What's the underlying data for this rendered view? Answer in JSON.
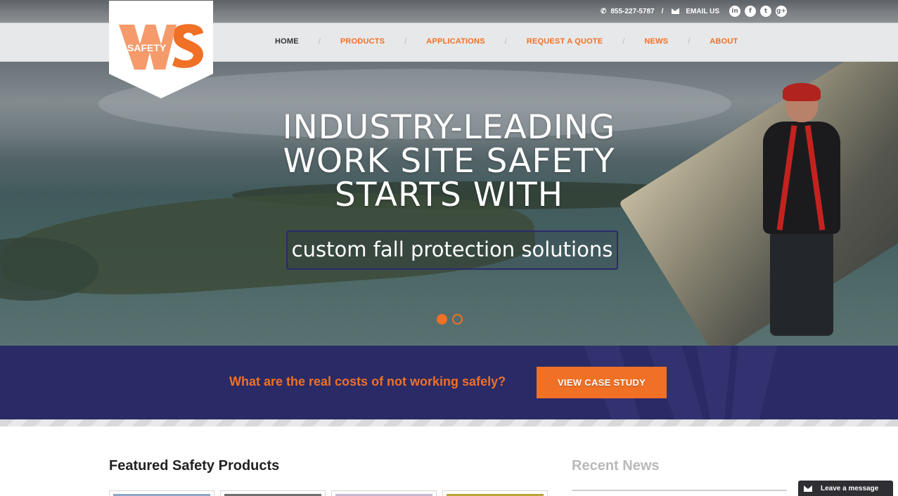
{
  "topbar": {
    "phone": "855-227-5787",
    "separator": "/",
    "email_label": "EMAIL US",
    "social": [
      {
        "name": "linkedin",
        "glyph": "in"
      },
      {
        "name": "facebook",
        "glyph": "f"
      },
      {
        "name": "twitter",
        "glyph": "t"
      },
      {
        "name": "google-plus",
        "glyph": "g+"
      }
    ]
  },
  "logo": {
    "text_left": "SAFETY",
    "text_mark": "WS",
    "brand_color": "#f07025"
  },
  "nav": {
    "items": [
      {
        "label": "HOME",
        "active": true
      },
      {
        "label": "PRODUCTS"
      },
      {
        "label": "APPLICATIONS"
      },
      {
        "label": "REQUEST A QUOTE"
      },
      {
        "label": "NEWS"
      },
      {
        "label": "ABOUT"
      }
    ],
    "divider": "/"
  },
  "hero": {
    "headline_lines": [
      "INDUSTRY-LEADING",
      "WORK SITE SAFETY",
      "STARTS WITH"
    ],
    "subline": "custom fall protection solutions",
    "slides": 2,
    "active_slide": 1
  },
  "cta": {
    "question": "What are the real costs of not working safely?",
    "button": "VIEW CASE STUDY",
    "bg_color": "#2a2a66"
  },
  "featured": {
    "title": "Featured Safety Products"
  },
  "news": {
    "title": "Recent News"
  },
  "chat": {
    "label": "Leave a message"
  }
}
